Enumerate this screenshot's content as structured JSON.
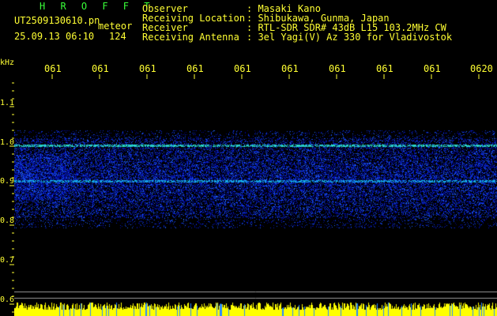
{
  "header": {
    "app_name": "H R O F F T",
    "file_name": "UT2509130610.pn",
    "file_tag": "meteor",
    "timestamp": "25.09.13 06:10",
    "count": "124"
  },
  "info": [
    {
      "label": "Observer",
      "value": ": Masaki Kano"
    },
    {
      "label": "Receiving Location",
      "value": ": Shibukawa, Gunma, Japan"
    },
    {
      "label": "Receiver",
      "value": ": RTL-SDR SDR# 43dB L15 103.2MHz CW"
    },
    {
      "label": "Receiving Antenna",
      "value": ": 3el Yagi(V) Az 330 for Vladivostok"
    }
  ],
  "axis": {
    "y_unit": "kHz",
    "y_ticks": [
      "1.1",
      "1.0",
      "0.9",
      "0.8",
      "0.7",
      "0.6"
    ],
    "x_ticks": [
      "061",
      "061",
      "061",
      "061",
      "061",
      "061",
      "061",
      "061",
      "061",
      "0620"
    ]
  },
  "colors": {
    "text": "#ffff33",
    "title": "#39ff39",
    "signal": "#2a52ff",
    "bottom_bar": "#ffff00"
  }
}
